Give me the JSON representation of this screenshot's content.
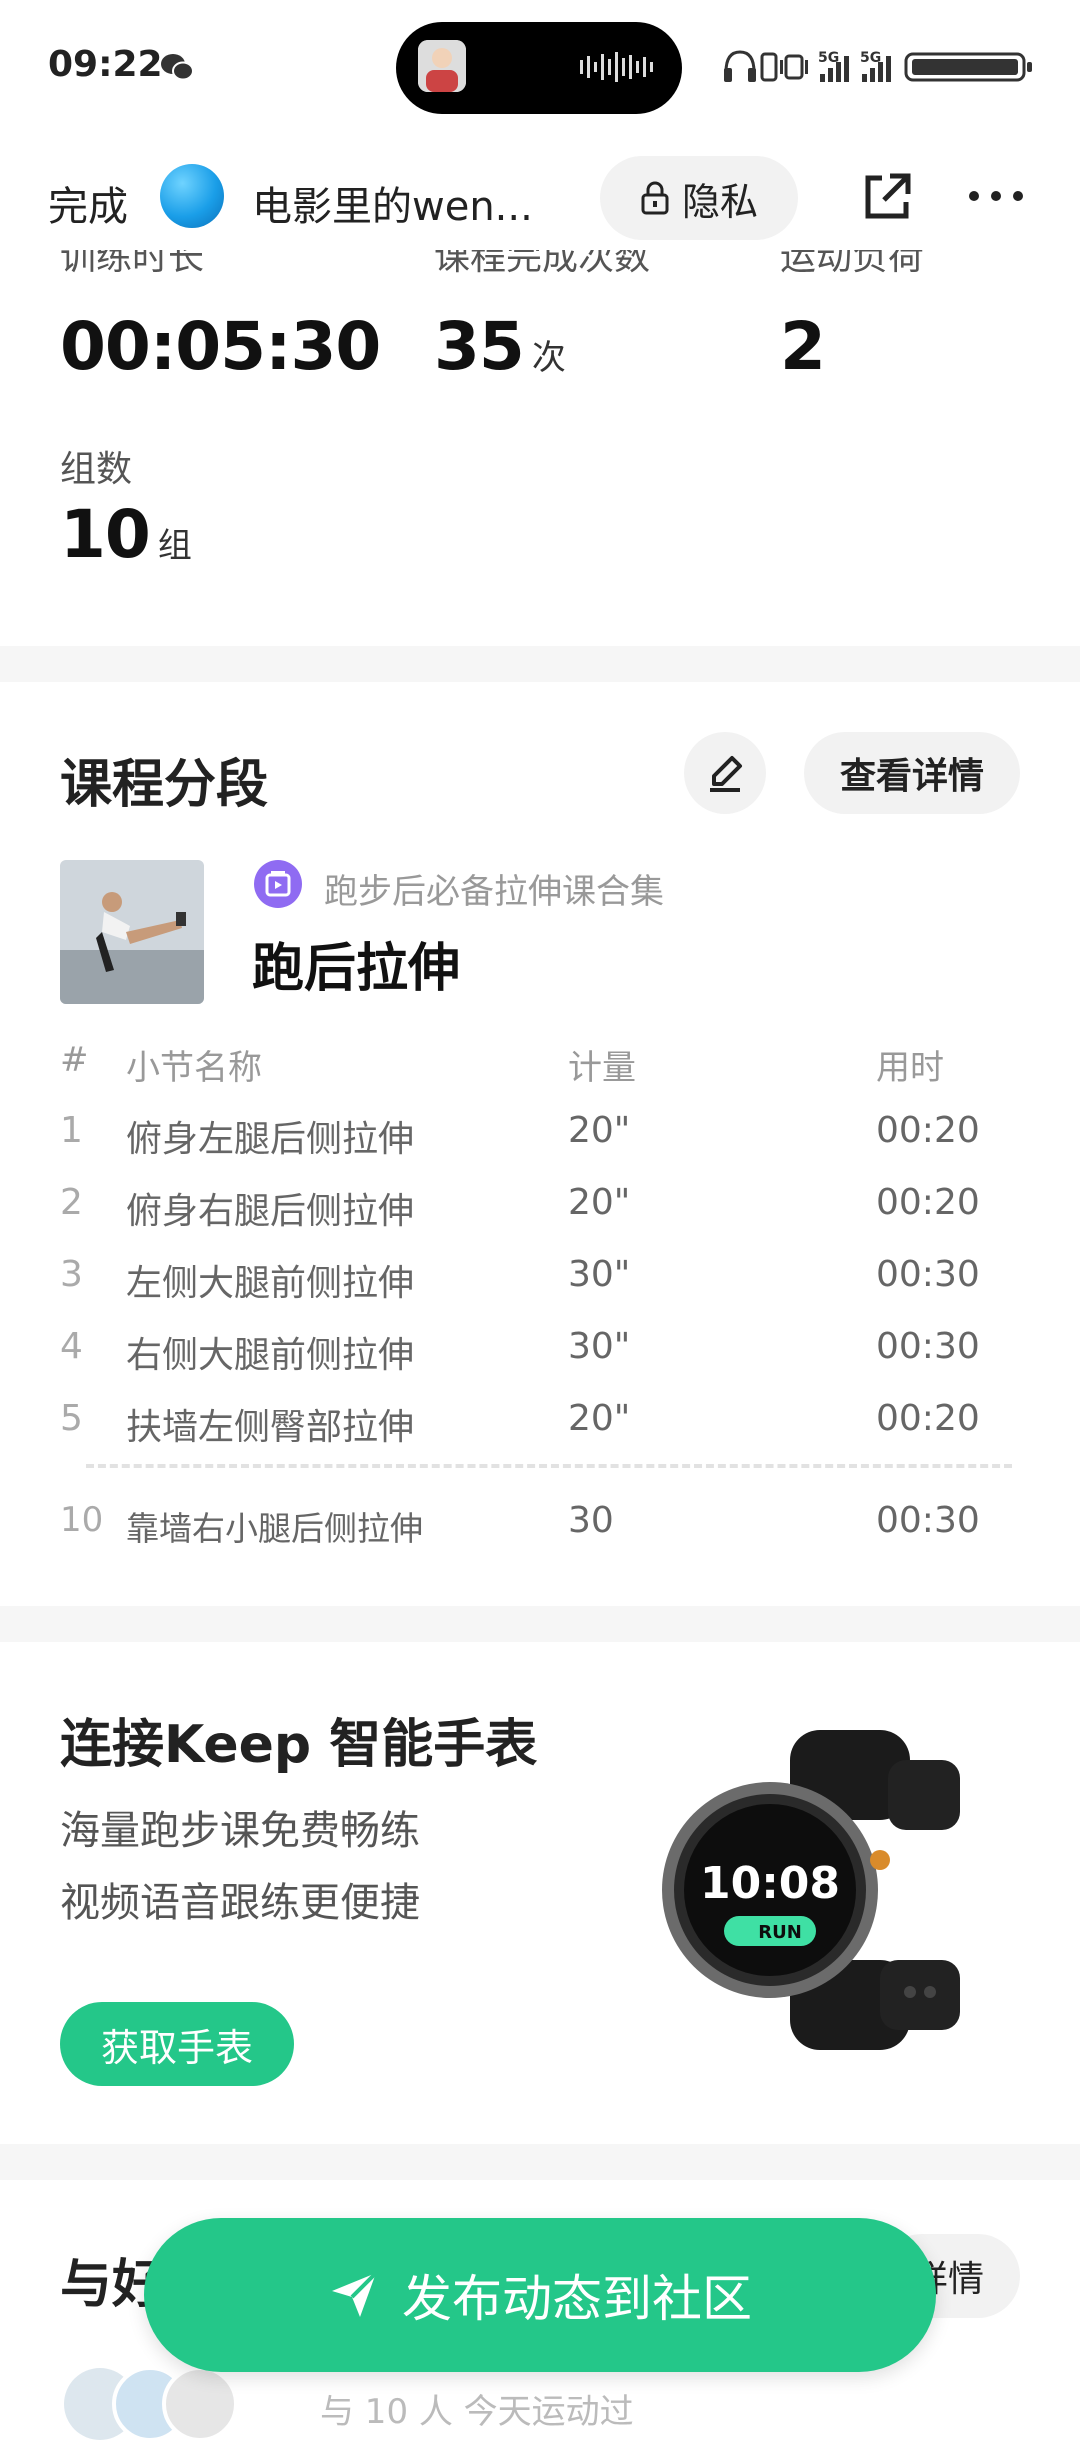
{
  "status_bar": {
    "time": "09:22"
  },
  "top_nav": {
    "done_label": "完成",
    "username": "电影里的wen...",
    "privacy_label": "隐私"
  },
  "stats": [
    {
      "label": "训练时长",
      "value": "00:05:30",
      "unit": ""
    },
    {
      "label": "课程完成次数",
      "value": "35",
      "unit": "次"
    },
    {
      "label": "运动负荷",
      "value": "2",
      "unit": ""
    },
    {
      "label": "组数",
      "value": "10",
      "unit": "组"
    }
  ],
  "course_section": {
    "title": "课程分段",
    "detail_label": "查看详情",
    "collection_label": "跑步后必备拉伸课合集",
    "course_title": "跑后拉伸",
    "table": {
      "headers": [
        "#",
        "小节名称",
        "计量",
        "用时"
      ],
      "rows": [
        {
          "index": "1",
          "name": "俯身左腿后侧拉伸",
          "amount": "20\"",
          "duration": "00:20"
        },
        {
          "index": "2",
          "name": "俯身右腿后侧拉伸",
          "amount": "20\"",
          "duration": "00:20"
        },
        {
          "index": "3",
          "name": "左侧大腿前侧拉伸",
          "amount": "30\"",
          "duration": "00:30"
        },
        {
          "index": "4",
          "name": "右侧大腿前侧拉伸",
          "amount": "30\"",
          "duration": "00:30"
        },
        {
          "index": "5",
          "name": "扶墙左侧臀部拉伸",
          "amount": "20\"",
          "duration": "00:20"
        },
        {
          "index": "10",
          "name": "靠墙右小腿后侧拉伸",
          "amount": "30",
          "duration": "00:30"
        }
      ]
    }
  },
  "watch_promo": {
    "title": "连接Keep 智能手表",
    "line1": "海量跑步课免费畅练",
    "line2": "视频语音跟练更便捷",
    "button_label": "获取手表",
    "watch_time": "10:08",
    "watch_label": "RUN"
  },
  "friends_section": {
    "title": "与好友",
    "detail_label": "详情",
    "subtitle": "与 10 人 今天运动过"
  },
  "publish_button": {
    "label": "发布动态到社区"
  },
  "colors": {
    "accent_green": "#24c789",
    "collection_purple": "#8f6bf2"
  }
}
